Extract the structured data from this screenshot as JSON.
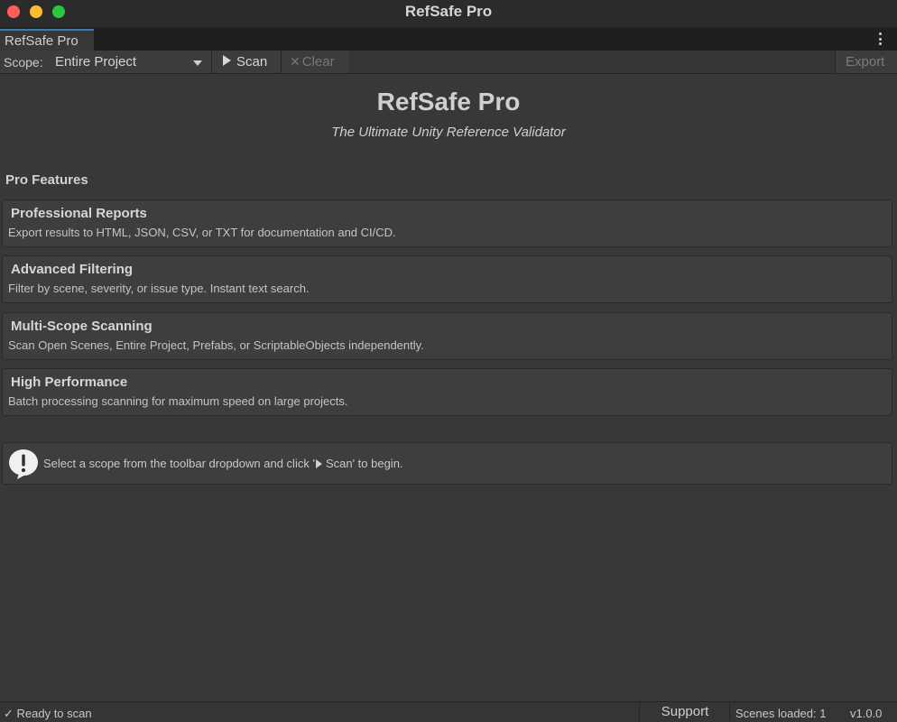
{
  "window": {
    "title": "RefSafe Pro"
  },
  "tab": {
    "label": "RefSafe Pro"
  },
  "toolbar": {
    "scope_label": "Scope:",
    "scope_value": "Entire Project",
    "scan_label": "Scan",
    "clear_label": "Clear",
    "export_label": "Export"
  },
  "header": {
    "title": "RefSafe Pro",
    "subtitle": "The Ultimate Unity Reference Validator"
  },
  "features_section": {
    "title": "Pro Features",
    "items": [
      {
        "title": "Professional Reports",
        "description": "Export results to HTML, JSON, CSV, or TXT for documentation and CI/CD."
      },
      {
        "title": "Advanced Filtering",
        "description": "Filter by scene, severity, or issue type. Instant text search."
      },
      {
        "title": "Multi-Scope Scanning",
        "description": "Scan Open Scenes, Entire Project, Prefabs, or ScriptableObjects independently."
      },
      {
        "title": "High Performance",
        "description": "Batch processing scanning for maximum speed on large projects."
      }
    ]
  },
  "info": {
    "icon": "speech-bubble-exclamation-icon",
    "text_before": "Select a scope from the toolbar dropdown and click '",
    "text_after": "Scan' to begin."
  },
  "status": {
    "ready": "✓ Ready to scan",
    "support_label": "Support",
    "scenes_loaded": "Scenes loaded: 1",
    "version": "v1.0.0"
  },
  "colors": {
    "background": "#383838",
    "card": "#3e3e3e",
    "tab_accent": "#3a79bb",
    "traffic_close": "#ff5f57",
    "traffic_minimize": "#febc2e",
    "traffic_maximize": "#28c840"
  }
}
